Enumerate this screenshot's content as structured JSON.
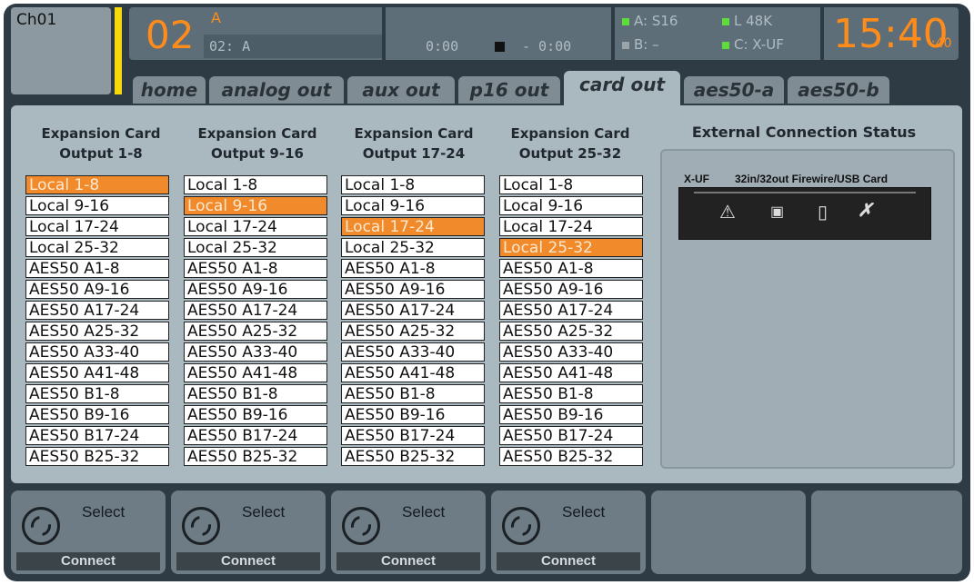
{
  "header": {
    "channel": "Ch01",
    "scene_number": "02",
    "scene_letter": "A",
    "scene_name": "02: A",
    "player_time": "0:00",
    "player_remaining": "- 0:00",
    "status": {
      "a": "A: S16",
      "b": "B:  –",
      "l": "L  48K",
      "c": "C: X-UF"
    },
    "clock_hm": "15:40",
    "clock_sec": ":40"
  },
  "tabs": [
    "home",
    "analog out",
    "aux out",
    "p16 out",
    "card out",
    "aes50-a",
    "aes50-b"
  ],
  "active_tab": "card out",
  "columns": [
    {
      "line1": "Expansion Card",
      "line2": "Output 1-8",
      "selected": 0
    },
    {
      "line1": "Expansion Card",
      "line2": "Output 9-16",
      "selected": 1
    },
    {
      "line1": "Expansion Card",
      "line2": "Output 17-24",
      "selected": 2
    },
    {
      "line1": "Expansion Card",
      "line2": "Output 25-32",
      "selected": 3
    }
  ],
  "sources": [
    "Local 1-8",
    "Local 9-16",
    "Local 17-24",
    "Local 25-32",
    "AES50 A1-8",
    "AES50 A9-16",
    "AES50 A17-24",
    "AES50 A25-32",
    "AES50 A33-40",
    "AES50 A41-48",
    "AES50 B1-8",
    "AES50 B9-16",
    "AES50 B17-24",
    "AES50 B25-32"
  ],
  "external": {
    "title": "External Connection Status",
    "card_name": "X-UF",
    "card_desc": "32in/32out Firewire/USB Card"
  },
  "bottom": [
    {
      "select": "Select",
      "connect": "Connect"
    },
    {
      "select": "Select",
      "connect": "Connect"
    },
    {
      "select": "Select",
      "connect": "Connect"
    },
    {
      "select": "Select",
      "connect": "Connect"
    }
  ],
  "colors": {
    "accent": "#ff8c1a",
    "selected": "#f08a2a",
    "panel": "#aab8c0"
  }
}
